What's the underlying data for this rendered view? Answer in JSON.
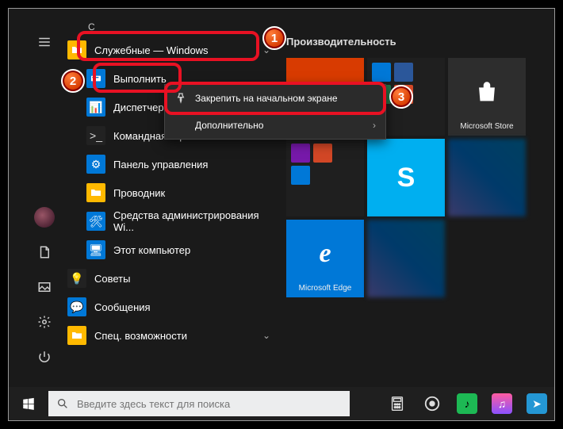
{
  "letter_header": "С",
  "folder_label": "Служебные — Windows",
  "apps": {
    "run": "Выполнить",
    "taskmgr": "Диспетчер задач",
    "cmd": "Командная строка",
    "control": "Панель управления",
    "explorer": "Проводник",
    "admintools": "Средства администрирования Wi...",
    "thispc": "Этот компьютер",
    "tips": "Советы",
    "messages": "Сообщения",
    "ease": "Спец. возможности"
  },
  "context_menu": {
    "pin": "Закрепить на начальном экране",
    "more": "Дополнительно"
  },
  "tiles": {
    "group_title": "Производительность",
    "edge": "Microsoft Edge",
    "store": "Microsoft Store"
  },
  "search": {
    "placeholder": "Введите здесь текст для поиска"
  },
  "badges": {
    "b1": "1",
    "b2": "2",
    "b3": "3"
  }
}
